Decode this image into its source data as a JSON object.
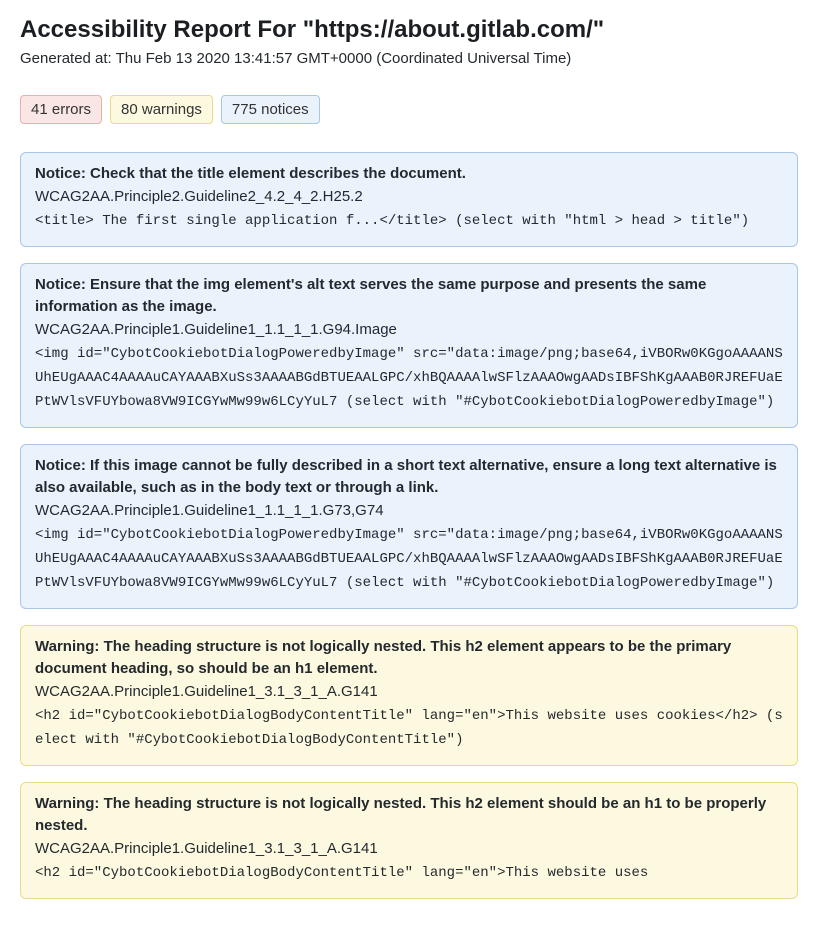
{
  "header": {
    "title_prefix": "Accessibility Report For \"",
    "url": "https://about.gitlab.com/",
    "title_suffix": "\"",
    "generated_label": "Generated at: ",
    "generated_at": "Thu Feb 13 2020 13:41:57 GMT+0000 (Coordinated Universal Time)"
  },
  "summary": {
    "errors": "41 errors",
    "warnings": "80 warnings",
    "notices": "775 notices"
  },
  "issues": [
    {
      "severity": "notice",
      "message": "Notice: Check that the title element describes the document.",
      "code": "WCAG2AA.Principle2.Guideline2_4.2_4_2.H25.2",
      "context": "<title>   The first single application f...</title> (select with \"html > head > title\")"
    },
    {
      "severity": "notice",
      "message": "Notice: Ensure that the img element's alt text serves the same purpose and presents the same information as the image.",
      "code": "WCAG2AA.Principle1.Guideline1_1.1_1_1.G94.Image",
      "context": "<img id=\"CybotCookiebotDialogPoweredbyImage\" src=\"data:image/png;base64,iVBORw0KGgoAAAANSUhEUgAAAC4AAAAuCAYAAABXuSs3AAAABGdBTUEAALGPC/xhBQAAAAlwSFlzAAAOwgAADsIBFShKgAAAB0RJREFUaEPtWVlsVFUYbowa8VW9ICGYwMw99w6LCyYuL7 (select with \"#CybotCookiebotDialogPoweredbyImage\")"
    },
    {
      "severity": "notice",
      "message": "Notice: If this image cannot be fully described in a short text alternative, ensure a long text alternative is also available, such as in the body text or through a link.",
      "code": "WCAG2AA.Principle1.Guideline1_1.1_1_1.G73,G74",
      "context": "<img id=\"CybotCookiebotDialogPoweredbyImage\" src=\"data:image/png;base64,iVBORw0KGgoAAAANSUhEUgAAAC4AAAAuCAYAAABXuSs3AAAABGdBTUEAALGPC/xhBQAAAAlwSFlzAAAOwgAADsIBFShKgAAAB0RJREFUaEPtWVlsVFUYbowa8VW9ICGYwMw99w6LCyYuL7 (select with \"#CybotCookiebotDialogPoweredbyImage\")"
    },
    {
      "severity": "warning",
      "message": "Warning: The heading structure is not logically nested. This h2 element appears to be the primary document heading, so should be an h1 element.",
      "code": "WCAG2AA.Principle1.Guideline1_3.1_3_1_A.G141",
      "context": "<h2 id=\"CybotCookiebotDialogBodyContentTitle\" lang=\"en\">This website uses cookies</h2> (select with \"#CybotCookiebotDialogBodyContentTitle\")"
    },
    {
      "severity": "warning",
      "message": "Warning: The heading structure is not logically nested. This h2 element should be an h1 to be properly nested.",
      "code": "WCAG2AA.Principle1.Guideline1_3.1_3_1_A.G141",
      "context": "<h2 id=\"CybotCookiebotDialogBodyContentTitle\" lang=\"en\">This website uses"
    }
  ]
}
